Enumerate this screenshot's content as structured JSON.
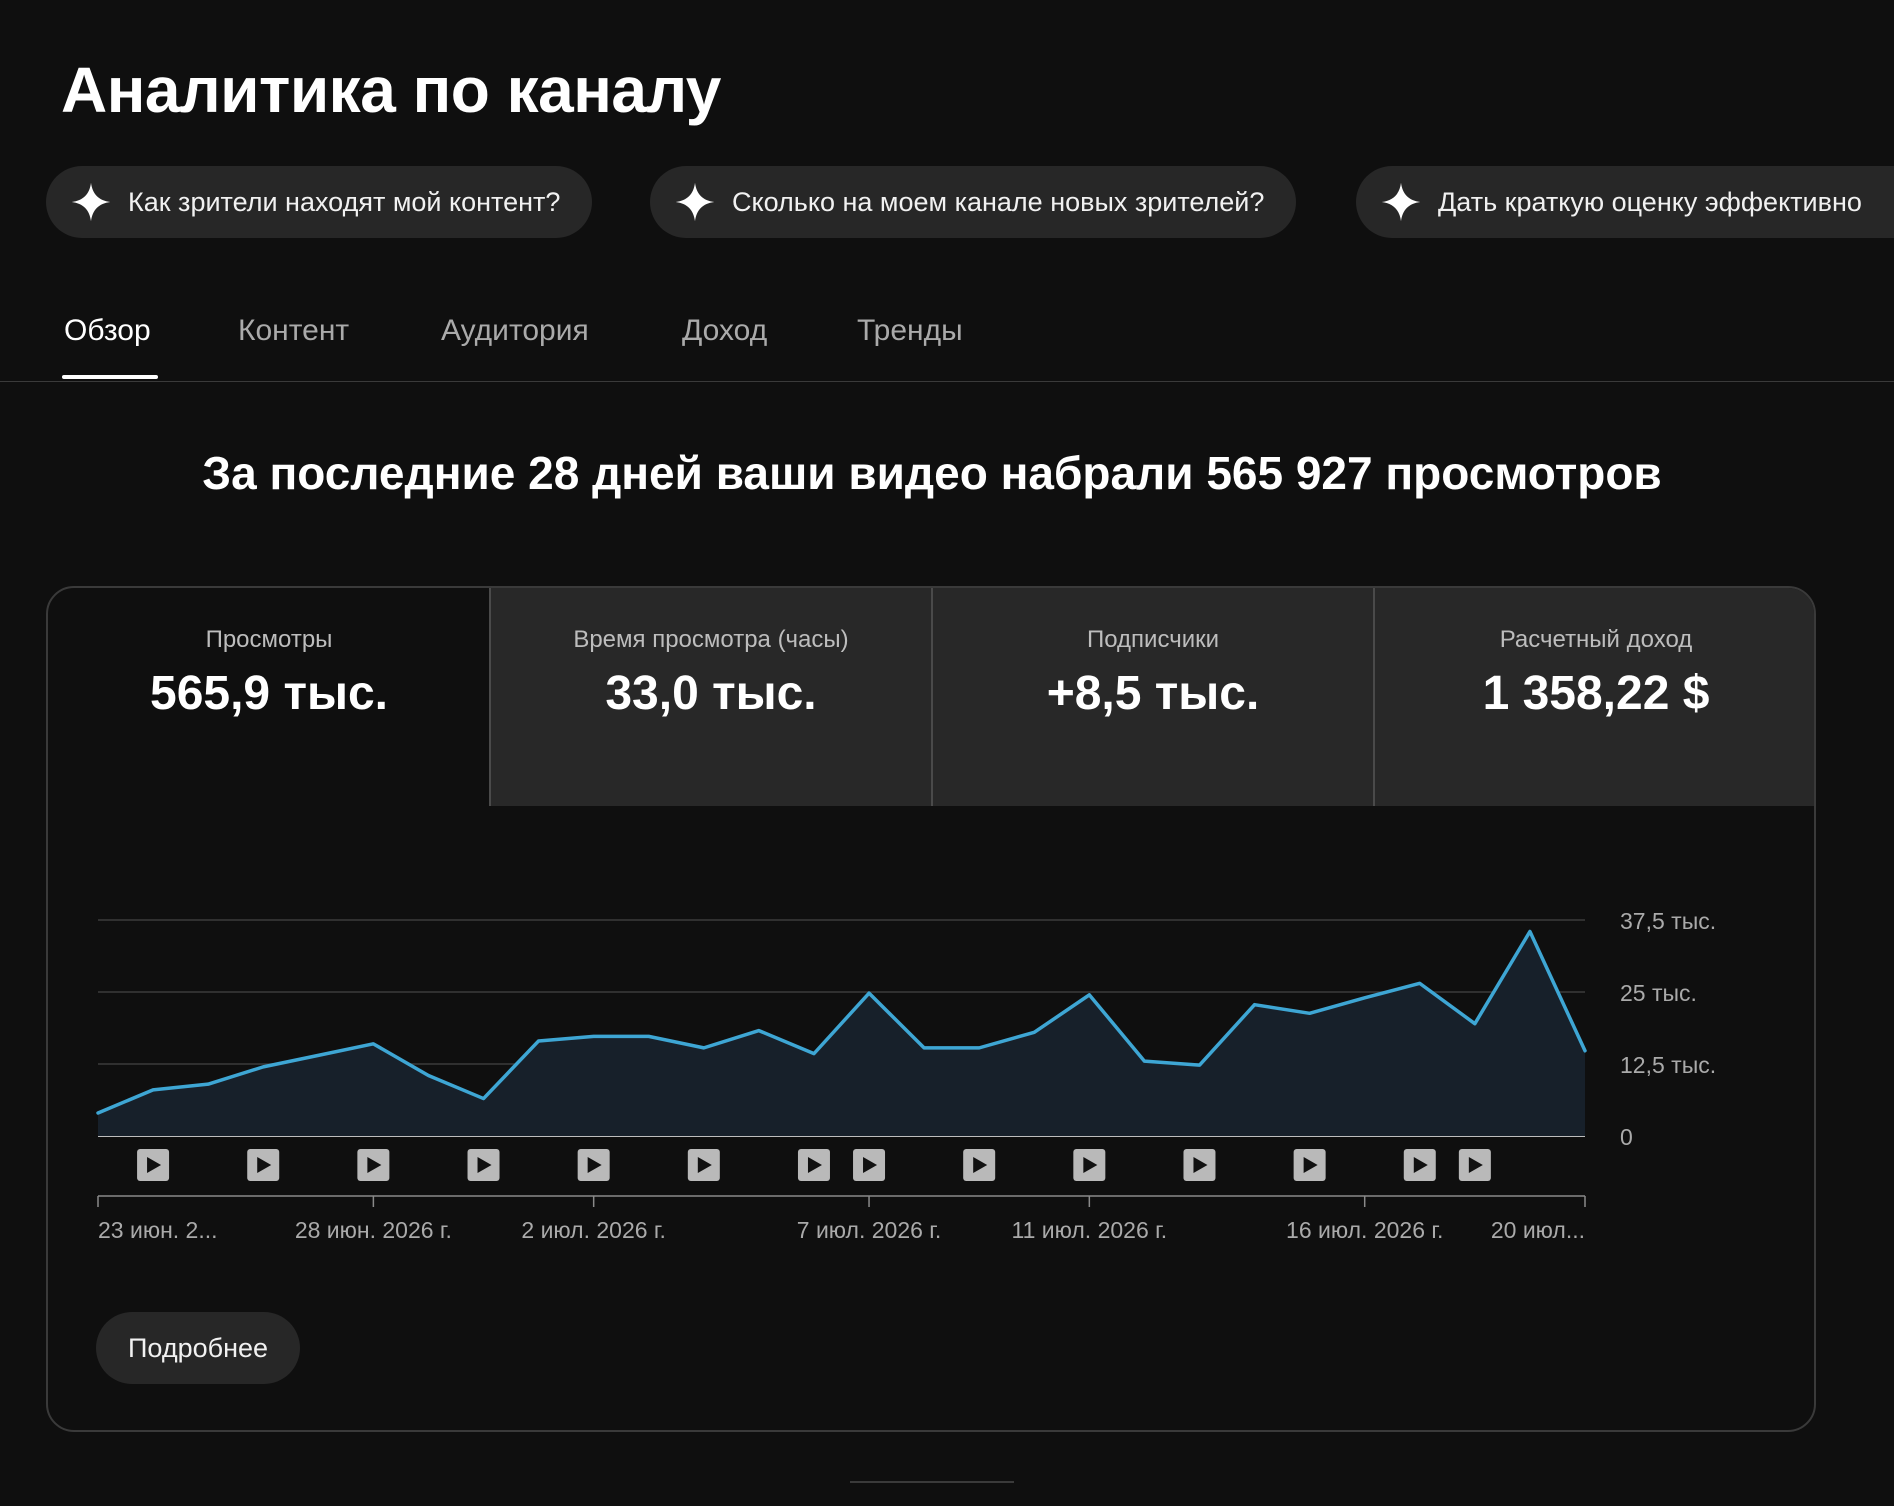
{
  "page": {
    "title": "Аналитика по каналу",
    "summary": "За последние 28 дней ваши видео набрали 565 927 просмотров"
  },
  "chips": [
    {
      "label": "Как зрители находят мой контент?",
      "icon": "sparkle-icon"
    },
    {
      "label": "Сколько на моем канале новых зрителей?",
      "icon": "sparkle-icon"
    },
    {
      "label": "Дать краткую оценку эффективно",
      "icon": "sparkle-icon"
    }
  ],
  "tabs": [
    {
      "label": "Обзор",
      "active": true
    },
    {
      "label": "Контент",
      "active": false
    },
    {
      "label": "Аудитория",
      "active": false
    },
    {
      "label": "Доход",
      "active": false
    },
    {
      "label": "Тренды",
      "active": false
    }
  ],
  "metrics": [
    {
      "label": "Просмотры",
      "value": "565,9 тыс.",
      "selected": true
    },
    {
      "label": "Время просмотра (часы)",
      "value": "33,0 тыс.",
      "selected": false
    },
    {
      "label": "Подписчики",
      "value": "+8,5 тыс.",
      "selected": false
    },
    {
      "label": "Расчетный доход",
      "value": "1 358,22 $",
      "selected": false
    }
  ],
  "more_button": {
    "label": "Подробнее"
  },
  "colors": {
    "background": "#0f0f0f",
    "line": "#3ea6d4",
    "area": "#17202a",
    "chip": "#272727"
  },
  "chart_data": {
    "type": "area",
    "series": [
      {
        "values": [
          4000,
          8000,
          9000,
          12000,
          14000,
          16000,
          10500,
          6500,
          16500,
          17300,
          17300,
          15300,
          18300,
          14300,
          24800,
          15300,
          15300,
          18000,
          24500,
          13000,
          12300,
          22800,
          21300,
          24000,
          26500,
          19500,
          35500,
          14800
        ]
      }
    ],
    "ylim": [
      0,
      37500
    ],
    "y_ticks": [
      {
        "value": 37500,
        "label": "37,5 тыс."
      },
      {
        "value": 25000,
        "label": "25 тыс."
      },
      {
        "value": 12500,
        "label": "12,5 тыс."
      },
      {
        "value": 0,
        "label": "0"
      }
    ],
    "x_labels": [
      {
        "index": 0,
        "label": "23 июн. 2..."
      },
      {
        "index": 5,
        "label": "28 июн. 2026 г."
      },
      {
        "index": 9,
        "label": "2 июл. 2026 г."
      },
      {
        "index": 14,
        "label": "7 июл. 2026 г."
      },
      {
        "index": 18,
        "label": "11 июл. 2026 г."
      },
      {
        "index": 23,
        "label": "16 июл. 2026 г."
      },
      {
        "index": 27,
        "label": "20 июл..."
      }
    ],
    "video_markers": [
      1,
      3,
      5,
      7,
      9,
      11,
      13,
      14,
      16,
      18,
      20,
      22,
      24,
      25
    ],
    "grid": true
  }
}
